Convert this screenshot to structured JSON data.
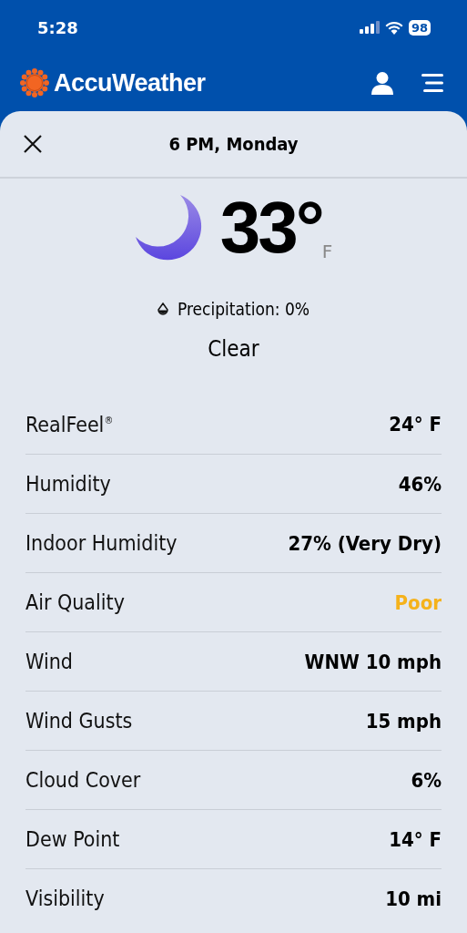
{
  "status_bar": {
    "time": "5:28",
    "battery": "98"
  },
  "header": {
    "brand": "AccuWeather"
  },
  "panel": {
    "title": "6 PM, Monday",
    "temperature": "33°",
    "unit": "F",
    "precipitation": "Precipitation: 0%",
    "condition": "Clear"
  },
  "details": [
    {
      "label": "RealFeel$^{®}$",
      "value": "24° F",
      "color": "#000000"
    },
    {
      "label": "Humidity",
      "value": "46%",
      "color": "#000000"
    },
    {
      "label": "Indoor Humidity",
      "value": "27% (Very Dry)",
      "color": "#000000"
    },
    {
      "label": "Air Quality",
      "value": "Poor",
      "color": "#f5b21b"
    },
    {
      "label": "Wind",
      "value": "WNW 10 mph",
      "color": "#000000"
    },
    {
      "label": "Wind Gusts",
      "value": "15 mph",
      "color": "#000000"
    },
    {
      "label": "Cloud Cover",
      "value": "6%",
      "color": "#000000"
    },
    {
      "label": "Dew Point",
      "value": "14° F",
      "color": "#000000"
    },
    {
      "label": "Visibility",
      "value": "10 mi",
      "color": "#000000"
    }
  ]
}
